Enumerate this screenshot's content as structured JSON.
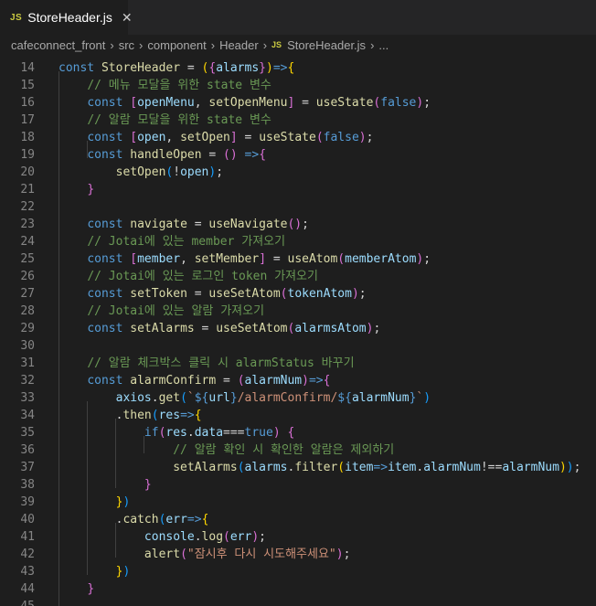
{
  "tab": {
    "badge": "JS",
    "title": "StoreHeader.js",
    "close_glyph": "✕"
  },
  "breadcrumb": {
    "items": [
      "cafeconnect_front",
      "src",
      "component",
      "Header"
    ],
    "file_badge": "JS",
    "file": "StoreHeader.js",
    "trailing": "...",
    "separator": "›"
  },
  "editor": {
    "lines": [
      {
        "n": "14",
        "t": [
          [
            "kw",
            "const "
          ],
          [
            "fn",
            "StoreHeader"
          ],
          [
            "op",
            " = "
          ],
          [
            "p1",
            "("
          ],
          [
            "p2",
            "{"
          ],
          [
            "var",
            "alarms"
          ],
          [
            "p2",
            "}"
          ],
          [
            "p1",
            ")"
          ],
          [
            "kw",
            "=>"
          ],
          [
            "p1",
            "{"
          ]
        ]
      },
      {
        "n": "15",
        "t": [
          [
            "op",
            "    "
          ],
          [
            "cm",
            "// 메뉴 모달을 위한 state 변수"
          ]
        ]
      },
      {
        "n": "16",
        "t": [
          [
            "op",
            "    "
          ],
          [
            "kw",
            "const "
          ],
          [
            "p2",
            "["
          ],
          [
            "var",
            "openMenu"
          ],
          [
            "op",
            ", "
          ],
          [
            "fn",
            "setOpenMenu"
          ],
          [
            "p2",
            "]"
          ],
          [
            "op",
            " = "
          ],
          [
            "fn",
            "useState"
          ],
          [
            "p2",
            "("
          ],
          [
            "kw",
            "false"
          ],
          [
            "p2",
            ")"
          ],
          [
            "op",
            ";"
          ]
        ]
      },
      {
        "n": "17",
        "t": [
          [
            "op",
            "    "
          ],
          [
            "cm",
            "// 알람 모달을 위한 state 변수"
          ]
        ]
      },
      {
        "n": "18",
        "t": [
          [
            "op",
            "    "
          ],
          [
            "kw",
            "const "
          ],
          [
            "p2",
            "["
          ],
          [
            "var",
            "open"
          ],
          [
            "op",
            ", "
          ],
          [
            "fn",
            "setOpen"
          ],
          [
            "p2",
            "]"
          ],
          [
            "op",
            " = "
          ],
          [
            "fn",
            "useState"
          ],
          [
            "p2",
            "("
          ],
          [
            "kw",
            "false"
          ],
          [
            "p2",
            ")"
          ],
          [
            "op",
            ";"
          ]
        ]
      },
      {
        "n": "19",
        "t": [
          [
            "op",
            "    "
          ],
          [
            "kw",
            "const "
          ],
          [
            "fn",
            "handleOpen"
          ],
          [
            "op",
            " = "
          ],
          [
            "p2",
            "()"
          ],
          [
            "op",
            " "
          ],
          [
            "kw",
            "=>"
          ],
          [
            "p2",
            "{"
          ]
        ]
      },
      {
        "n": "20",
        "t": [
          [
            "op",
            "        "
          ],
          [
            "fn",
            "setOpen"
          ],
          [
            "p3",
            "("
          ],
          [
            "op",
            "!"
          ],
          [
            "var",
            "open"
          ],
          [
            "p3",
            ")"
          ],
          [
            "op",
            ";"
          ]
        ]
      },
      {
        "n": "21",
        "t": [
          [
            "op",
            "    "
          ],
          [
            "p2",
            "}"
          ]
        ]
      },
      {
        "n": "22",
        "t": []
      },
      {
        "n": "23",
        "t": [
          [
            "op",
            "    "
          ],
          [
            "kw",
            "const "
          ],
          [
            "fn",
            "navigate"
          ],
          [
            "op",
            " = "
          ],
          [
            "fn",
            "useNavigate"
          ],
          [
            "p2",
            "()"
          ],
          [
            "op",
            ";"
          ]
        ]
      },
      {
        "n": "24",
        "t": [
          [
            "op",
            "    "
          ],
          [
            "cm",
            "// Jotai에 있는 member 가져오기"
          ]
        ]
      },
      {
        "n": "25",
        "t": [
          [
            "op",
            "    "
          ],
          [
            "kw",
            "const "
          ],
          [
            "p2",
            "["
          ],
          [
            "var",
            "member"
          ],
          [
            "op",
            ", "
          ],
          [
            "fn",
            "setMember"
          ],
          [
            "p2",
            "]"
          ],
          [
            "op",
            " = "
          ],
          [
            "fn",
            "useAtom"
          ],
          [
            "p2",
            "("
          ],
          [
            "var",
            "memberAtom"
          ],
          [
            "p2",
            ")"
          ],
          [
            "op",
            ";"
          ]
        ]
      },
      {
        "n": "26",
        "t": [
          [
            "op",
            "    "
          ],
          [
            "cm",
            "// Jotai에 있는 로그인 token 가져오기"
          ]
        ]
      },
      {
        "n": "27",
        "t": [
          [
            "op",
            "    "
          ],
          [
            "kw",
            "const "
          ],
          [
            "fn",
            "setToken"
          ],
          [
            "op",
            " = "
          ],
          [
            "fn",
            "useSetAtom"
          ],
          [
            "p2",
            "("
          ],
          [
            "var",
            "tokenAtom"
          ],
          [
            "p2",
            ")"
          ],
          [
            "op",
            ";"
          ]
        ]
      },
      {
        "n": "28",
        "t": [
          [
            "op",
            "    "
          ],
          [
            "cm",
            "// Jotai에 있는 알람 가져오기"
          ]
        ]
      },
      {
        "n": "29",
        "t": [
          [
            "op",
            "    "
          ],
          [
            "kw",
            "const "
          ],
          [
            "fn",
            "setAlarms"
          ],
          [
            "op",
            " = "
          ],
          [
            "fn",
            "useSetAtom"
          ],
          [
            "p2",
            "("
          ],
          [
            "var",
            "alarmsAtom"
          ],
          [
            "p2",
            ")"
          ],
          [
            "op",
            ";"
          ]
        ]
      },
      {
        "n": "30",
        "t": []
      },
      {
        "n": "31",
        "t": [
          [
            "op",
            "    "
          ],
          [
            "cm",
            "// 알람 체크박스 클릭 시 alarmStatus 바꾸기"
          ]
        ]
      },
      {
        "n": "32",
        "t": [
          [
            "op",
            "    "
          ],
          [
            "kw",
            "const "
          ],
          [
            "fn",
            "alarmConfirm"
          ],
          [
            "op",
            " = "
          ],
          [
            "p2",
            "("
          ],
          [
            "var",
            "alarmNum"
          ],
          [
            "p2",
            ")"
          ],
          [
            "kw",
            "=>"
          ],
          [
            "p2",
            "{"
          ]
        ]
      },
      {
        "n": "33",
        "t": [
          [
            "op",
            "        "
          ],
          [
            "var",
            "axios"
          ],
          [
            "op",
            "."
          ],
          [
            "fn",
            "get"
          ],
          [
            "p3",
            "("
          ],
          [
            "str",
            "`"
          ],
          [
            "kw",
            "${"
          ],
          [
            "var",
            "url"
          ],
          [
            "kw",
            "}"
          ],
          [
            "str",
            "/alarmConfirm/"
          ],
          [
            "kw",
            "${"
          ],
          [
            "var",
            "alarmNum"
          ],
          [
            "kw",
            "}"
          ],
          [
            "str",
            "`"
          ],
          [
            "p3",
            ")"
          ]
        ]
      },
      {
        "n": "34",
        "t": [
          [
            "op",
            "        ."
          ],
          [
            "fn",
            "then"
          ],
          [
            "p3",
            "("
          ],
          [
            "var",
            "res"
          ],
          [
            "kw",
            "=>"
          ],
          [
            "p1",
            "{"
          ]
        ]
      },
      {
        "n": "35",
        "t": [
          [
            "op",
            "            "
          ],
          [
            "kw",
            "if"
          ],
          [
            "p2",
            "("
          ],
          [
            "var",
            "res"
          ],
          [
            "op",
            "."
          ],
          [
            "var",
            "data"
          ],
          [
            "op",
            "==="
          ],
          [
            "kw",
            "true"
          ],
          [
            "p2",
            ")"
          ],
          [
            "op",
            " "
          ],
          [
            "p2",
            "{"
          ]
        ]
      },
      {
        "n": "36",
        "t": [
          [
            "op",
            "                "
          ],
          [
            "cm",
            "// 알람 확인 시 확인한 알람은 제외하기"
          ]
        ]
      },
      {
        "n": "37",
        "t": [
          [
            "op",
            "                "
          ],
          [
            "fn",
            "setAlarms"
          ],
          [
            "p3",
            "("
          ],
          [
            "var",
            "alarms"
          ],
          [
            "op",
            "."
          ],
          [
            "fn",
            "filter"
          ],
          [
            "p1",
            "("
          ],
          [
            "var",
            "item"
          ],
          [
            "kw",
            "=>"
          ],
          [
            "var",
            "item"
          ],
          [
            "op",
            "."
          ],
          [
            "var",
            "alarmNum"
          ],
          [
            "op",
            "!=="
          ],
          [
            "var",
            "alarmNum"
          ],
          [
            "p1",
            ")"
          ],
          [
            "p3",
            ")"
          ],
          [
            "op",
            ";"
          ]
        ]
      },
      {
        "n": "38",
        "t": [
          [
            "op",
            "            "
          ],
          [
            "p2",
            "}"
          ]
        ]
      },
      {
        "n": "39",
        "t": [
          [
            "op",
            "        "
          ],
          [
            "p1",
            "}"
          ],
          [
            "p3",
            ")"
          ]
        ]
      },
      {
        "n": "40",
        "t": [
          [
            "op",
            "        ."
          ],
          [
            "fn",
            "catch"
          ],
          [
            "p3",
            "("
          ],
          [
            "var",
            "err"
          ],
          [
            "kw",
            "=>"
          ],
          [
            "p1",
            "{"
          ]
        ]
      },
      {
        "n": "41",
        "t": [
          [
            "op",
            "            "
          ],
          [
            "var",
            "console"
          ],
          [
            "op",
            "."
          ],
          [
            "fn",
            "log"
          ],
          [
            "p2",
            "("
          ],
          [
            "var",
            "err"
          ],
          [
            "p2",
            ")"
          ],
          [
            "op",
            ";"
          ]
        ]
      },
      {
        "n": "42",
        "t": [
          [
            "op",
            "            "
          ],
          [
            "fn",
            "alert"
          ],
          [
            "p2",
            "("
          ],
          [
            "str",
            "\"잠시후 다시 시도해주세요\""
          ],
          [
            "p2",
            ")"
          ],
          [
            "op",
            ";"
          ]
        ]
      },
      {
        "n": "43",
        "t": [
          [
            "op",
            "        "
          ],
          [
            "p1",
            "}"
          ],
          [
            "p3",
            ")"
          ]
        ]
      },
      {
        "n": "44",
        "t": [
          [
            "op",
            "    "
          ],
          [
            "p2",
            "}"
          ]
        ]
      },
      {
        "n": "45",
        "t": []
      }
    ]
  },
  "colors": {
    "background": "#1e1e1e",
    "keyword": "#569cd6",
    "function": "#dcdcaa",
    "variable": "#9cdcfe",
    "comment": "#6a9955",
    "string": "#ce9178"
  }
}
